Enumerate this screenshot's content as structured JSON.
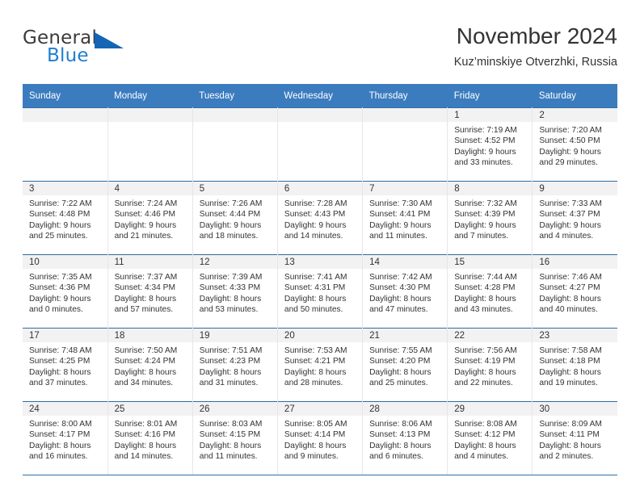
{
  "logo": {
    "word_top": "General",
    "word_bottom": "Blue",
    "accent_color": "#1f7fd0",
    "triangle_color": "#1565b5"
  },
  "header": {
    "title": "November 2024",
    "subtitle": "Kuz’minskiye Otverzhki, Russia",
    "header_bg": "#3b7cbf",
    "row_border": "#2e6da4"
  },
  "weekday_headers": [
    "Sunday",
    "Monday",
    "Tuesday",
    "Wednesday",
    "Thursday",
    "Friday",
    "Saturday"
  ],
  "weeks": [
    [
      {
        "day": "",
        "lines": []
      },
      {
        "day": "",
        "lines": []
      },
      {
        "day": "",
        "lines": []
      },
      {
        "day": "",
        "lines": []
      },
      {
        "day": "",
        "lines": []
      },
      {
        "day": "1",
        "lines": [
          "Sunrise: 7:19 AM",
          "Sunset: 4:52 PM",
          "Daylight: 9 hours",
          "and 33 minutes."
        ]
      },
      {
        "day": "2",
        "lines": [
          "Sunrise: 7:20 AM",
          "Sunset: 4:50 PM",
          "Daylight: 9 hours",
          "and 29 minutes."
        ]
      }
    ],
    [
      {
        "day": "3",
        "lines": [
          "Sunrise: 7:22 AM",
          "Sunset: 4:48 PM",
          "Daylight: 9 hours",
          "and 25 minutes."
        ]
      },
      {
        "day": "4",
        "lines": [
          "Sunrise: 7:24 AM",
          "Sunset: 4:46 PM",
          "Daylight: 9 hours",
          "and 21 minutes."
        ]
      },
      {
        "day": "5",
        "lines": [
          "Sunrise: 7:26 AM",
          "Sunset: 4:44 PM",
          "Daylight: 9 hours",
          "and 18 minutes."
        ]
      },
      {
        "day": "6",
        "lines": [
          "Sunrise: 7:28 AM",
          "Sunset: 4:43 PM",
          "Daylight: 9 hours",
          "and 14 minutes."
        ]
      },
      {
        "day": "7",
        "lines": [
          "Sunrise: 7:30 AM",
          "Sunset: 4:41 PM",
          "Daylight: 9 hours",
          "and 11 minutes."
        ]
      },
      {
        "day": "8",
        "lines": [
          "Sunrise: 7:32 AM",
          "Sunset: 4:39 PM",
          "Daylight: 9 hours",
          "and 7 minutes."
        ]
      },
      {
        "day": "9",
        "lines": [
          "Sunrise: 7:33 AM",
          "Sunset: 4:37 PM",
          "Daylight: 9 hours",
          "and 4 minutes."
        ]
      }
    ],
    [
      {
        "day": "10",
        "lines": [
          "Sunrise: 7:35 AM",
          "Sunset: 4:36 PM",
          "Daylight: 9 hours",
          "and 0 minutes."
        ]
      },
      {
        "day": "11",
        "lines": [
          "Sunrise: 7:37 AM",
          "Sunset: 4:34 PM",
          "Daylight: 8 hours",
          "and 57 minutes."
        ]
      },
      {
        "day": "12",
        "lines": [
          "Sunrise: 7:39 AM",
          "Sunset: 4:33 PM",
          "Daylight: 8 hours",
          "and 53 minutes."
        ]
      },
      {
        "day": "13",
        "lines": [
          "Sunrise: 7:41 AM",
          "Sunset: 4:31 PM",
          "Daylight: 8 hours",
          "and 50 minutes."
        ]
      },
      {
        "day": "14",
        "lines": [
          "Sunrise: 7:42 AM",
          "Sunset: 4:30 PM",
          "Daylight: 8 hours",
          "and 47 minutes."
        ]
      },
      {
        "day": "15",
        "lines": [
          "Sunrise: 7:44 AM",
          "Sunset: 4:28 PM",
          "Daylight: 8 hours",
          "and 43 minutes."
        ]
      },
      {
        "day": "16",
        "lines": [
          "Sunrise: 7:46 AM",
          "Sunset: 4:27 PM",
          "Daylight: 8 hours",
          "and 40 minutes."
        ]
      }
    ],
    [
      {
        "day": "17",
        "lines": [
          "Sunrise: 7:48 AM",
          "Sunset: 4:25 PM",
          "Daylight: 8 hours",
          "and 37 minutes."
        ]
      },
      {
        "day": "18",
        "lines": [
          "Sunrise: 7:50 AM",
          "Sunset: 4:24 PM",
          "Daylight: 8 hours",
          "and 34 minutes."
        ]
      },
      {
        "day": "19",
        "lines": [
          "Sunrise: 7:51 AM",
          "Sunset: 4:23 PM",
          "Daylight: 8 hours",
          "and 31 minutes."
        ]
      },
      {
        "day": "20",
        "lines": [
          "Sunrise: 7:53 AM",
          "Sunset: 4:21 PM",
          "Daylight: 8 hours",
          "and 28 minutes."
        ]
      },
      {
        "day": "21",
        "lines": [
          "Sunrise: 7:55 AM",
          "Sunset: 4:20 PM",
          "Daylight: 8 hours",
          "and 25 minutes."
        ]
      },
      {
        "day": "22",
        "lines": [
          "Sunrise: 7:56 AM",
          "Sunset: 4:19 PM",
          "Daylight: 8 hours",
          "and 22 minutes."
        ]
      },
      {
        "day": "23",
        "lines": [
          "Sunrise: 7:58 AM",
          "Sunset: 4:18 PM",
          "Daylight: 8 hours",
          "and 19 minutes."
        ]
      }
    ],
    [
      {
        "day": "24",
        "lines": [
          "Sunrise: 8:00 AM",
          "Sunset: 4:17 PM",
          "Daylight: 8 hours",
          "and 16 minutes."
        ]
      },
      {
        "day": "25",
        "lines": [
          "Sunrise: 8:01 AM",
          "Sunset: 4:16 PM",
          "Daylight: 8 hours",
          "and 14 minutes."
        ]
      },
      {
        "day": "26",
        "lines": [
          "Sunrise: 8:03 AM",
          "Sunset: 4:15 PM",
          "Daylight: 8 hours",
          "and 11 minutes."
        ]
      },
      {
        "day": "27",
        "lines": [
          "Sunrise: 8:05 AM",
          "Sunset: 4:14 PM",
          "Daylight: 8 hours",
          "and 9 minutes."
        ]
      },
      {
        "day": "28",
        "lines": [
          "Sunrise: 8:06 AM",
          "Sunset: 4:13 PM",
          "Daylight: 8 hours",
          "and 6 minutes."
        ]
      },
      {
        "day": "29",
        "lines": [
          "Sunrise: 8:08 AM",
          "Sunset: 4:12 PM",
          "Daylight: 8 hours",
          "and 4 minutes."
        ]
      },
      {
        "day": "30",
        "lines": [
          "Sunrise: 8:09 AM",
          "Sunset: 4:11 PM",
          "Daylight: 8 hours",
          "and 2 minutes."
        ]
      }
    ]
  ]
}
